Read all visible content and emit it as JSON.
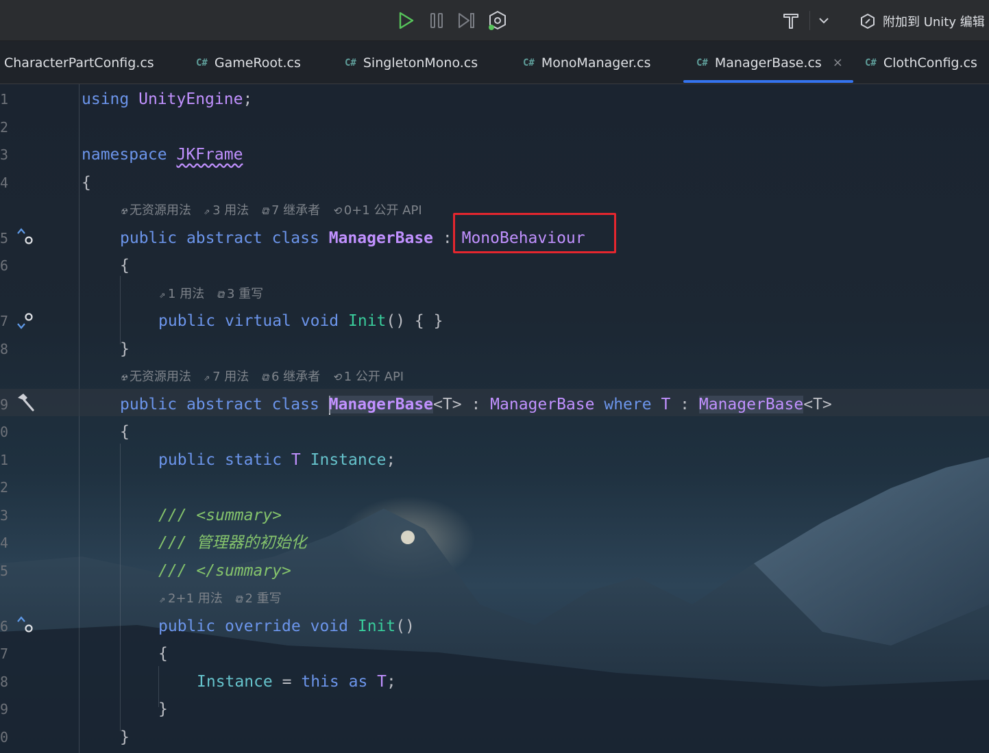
{
  "toolbar": {
    "run_icon": "play-icon",
    "pause_icon": "pause-icon",
    "step_icon": "step-icon",
    "debug_icon": "debug-icon",
    "tool_icon": "hammer-icon",
    "attach_label": "附加到 Unity 编辑"
  },
  "tabs": [
    {
      "label": "CharacterPartConfig.cs",
      "cs": ""
    },
    {
      "label": "GameRoot.cs",
      "cs": "C#"
    },
    {
      "label": "SingletonMono.cs",
      "cs": "C#"
    },
    {
      "label": "MonoManager.cs",
      "cs": "C#"
    },
    {
      "label": "ManagerBase.cs",
      "cs": "C#",
      "active": true,
      "close": "×"
    },
    {
      "label": "ClothConfig.cs",
      "cs": "C#"
    }
  ],
  "line_numbers": [
    "1",
    "2",
    "3",
    "4",
    "5",
    "6",
    "7",
    "8",
    "9",
    "0",
    "1",
    "2",
    "3",
    "4",
    "5",
    "6",
    "7",
    "8",
    "9",
    "0"
  ],
  "code": {
    "l1_kw": "using",
    "l1_ns": "UnityEngine",
    "l1_end": ";",
    "l3_kw": "namespace",
    "l3_ns": "JKFrame",
    "open_brace": "{",
    "close_brace": "}",
    "l5_kw1": "public",
    "l5_kw2": "abstract",
    "l5_kw3": "class",
    "l5_name": "ManagerBase",
    "l5_colon": ":",
    "l5_base": "MonoBehaviour",
    "l7_kw1": "public",
    "l7_kw2": "virtual",
    "l7_kw3": "void",
    "l7_fn": "Init",
    "l7_rest": "() { }",
    "l9_kw1": "public",
    "l9_kw2": "abstract",
    "l9_kw3": "class",
    "l9_name": "ManagerBase",
    "l9_gen": "<T>",
    "l9_colon": ":",
    "l9_base": "ManagerBase",
    "l9_where": "where",
    "l9_t": "T",
    "l9_colon2": ":",
    "l9_base2": "ManagerBase",
    "l9_gen2": "<T>",
    "l11_kw1": "public",
    "l11_kw2": "static",
    "l11_t": "T",
    "l11_id": "Instance",
    "l11_end": ";",
    "l13_slash": "///",
    "l13_tag": "<summary>",
    "l14_slash": "///",
    "l14_text": "管理器的初始化",
    "l15_slash": "///",
    "l15_tag": "</summary>",
    "l16_kw1": "public",
    "l16_kw2": "override",
    "l16_kw3": "void",
    "l16_fn": "Init",
    "l16_rest": "()",
    "l18_id": "Instance",
    "l18_eq": "=",
    "l18_this": "this",
    "l18_as": "as",
    "l18_t": "T",
    "l18_end": ";"
  },
  "hints": {
    "h1": [
      "无资源用法",
      "3 用法",
      "7 继承者",
      "0+1 公开 API"
    ],
    "h2": [
      "1 用法",
      "3 重写"
    ],
    "h3": [
      "无资源用法",
      "7 用法",
      "6 继承者",
      "1 公开 API"
    ],
    "h4": [
      "2+1 用法",
      "2 重写"
    ]
  },
  "hint_icons": {
    "unity": "☢",
    "usage": "⇗",
    "inherit": "⧉",
    "api": "⟲"
  }
}
